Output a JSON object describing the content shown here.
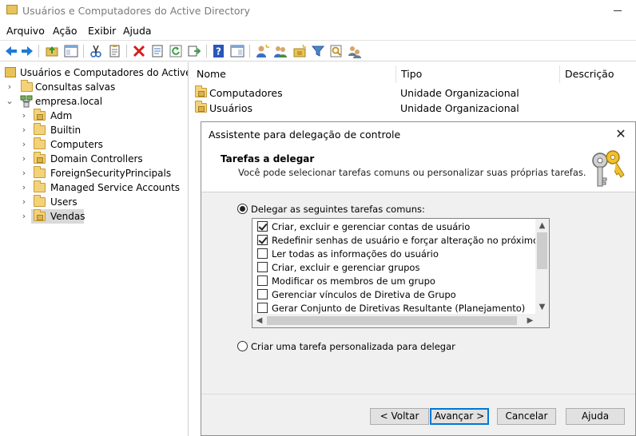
{
  "window": {
    "title": "Usuários e Computadores do Active Directory"
  },
  "menu": [
    "Arquivo",
    "Ação",
    "Exibir",
    "Ajuda"
  ],
  "toolbar": {
    "icons": [
      "back-arrow-icon",
      "forward-arrow-icon",
      "up-folder-icon",
      "console-tree-icon",
      "cut-icon",
      "copy-icon",
      "delete-icon",
      "properties-icon",
      "refresh-icon",
      "export-list-icon",
      "help-icon",
      "show-pane-icon",
      "new-user-icon",
      "new-group-icon",
      "new-ou-icon",
      "filter-icon",
      "find-icon",
      "add-to-group-icon"
    ]
  },
  "tree": {
    "root": "Usuários e Computadores do Active Dir",
    "saved_queries": "Consultas salvas",
    "domain": "empresa.local",
    "items": [
      "Adm",
      "Builtin",
      "Computers",
      "Domain Controllers",
      "ForeignSecurityPrincipals",
      "Managed Service Accounts",
      "Users",
      "Vendas"
    ],
    "selected": "Vendas"
  },
  "list": {
    "columns": [
      "Nome",
      "Tipo",
      "Descrição"
    ],
    "rows": [
      {
        "name": "Computadores",
        "type": "Unidade Organizacional"
      },
      {
        "name": "Usuários",
        "type": "Unidade Organizacional"
      }
    ]
  },
  "dialog": {
    "title": "Assistente para delegação de controle",
    "header": "Tarefas a delegar",
    "subheader": "Você pode selecionar tarefas comuns ou personalizar suas próprias tarefas.",
    "option_common": "Delegar as seguintes tarefas comuns:",
    "option_custom": "Criar uma tarefa personalizada para delegar",
    "selected_option": "common",
    "tasks": [
      {
        "label": "Criar, excluir e gerenciar contas de usuário",
        "checked": true
      },
      {
        "label": "Redefinir senhas de usuário e forçar alteração no próximo logon",
        "checked": true
      },
      {
        "label": "Ler todas as informações do usuário",
        "checked": false
      },
      {
        "label": "Criar, excluir e gerenciar grupos",
        "checked": false
      },
      {
        "label": "Modificar os membros de um grupo",
        "checked": false
      },
      {
        "label": "Gerenciar vínculos de Diretiva de Grupo",
        "checked": false
      },
      {
        "label": "Gerar Conjunto de Diretivas Resultante (Planejamento)",
        "checked": false
      }
    ],
    "buttons": {
      "back": "< Voltar",
      "next": "Avançar >",
      "cancel": "Cancelar",
      "help": "Ajuda"
    }
  },
  "colors": {
    "accent": "#0078d7",
    "folder": "#f3d27a",
    "selection": "#d9d9d9"
  }
}
